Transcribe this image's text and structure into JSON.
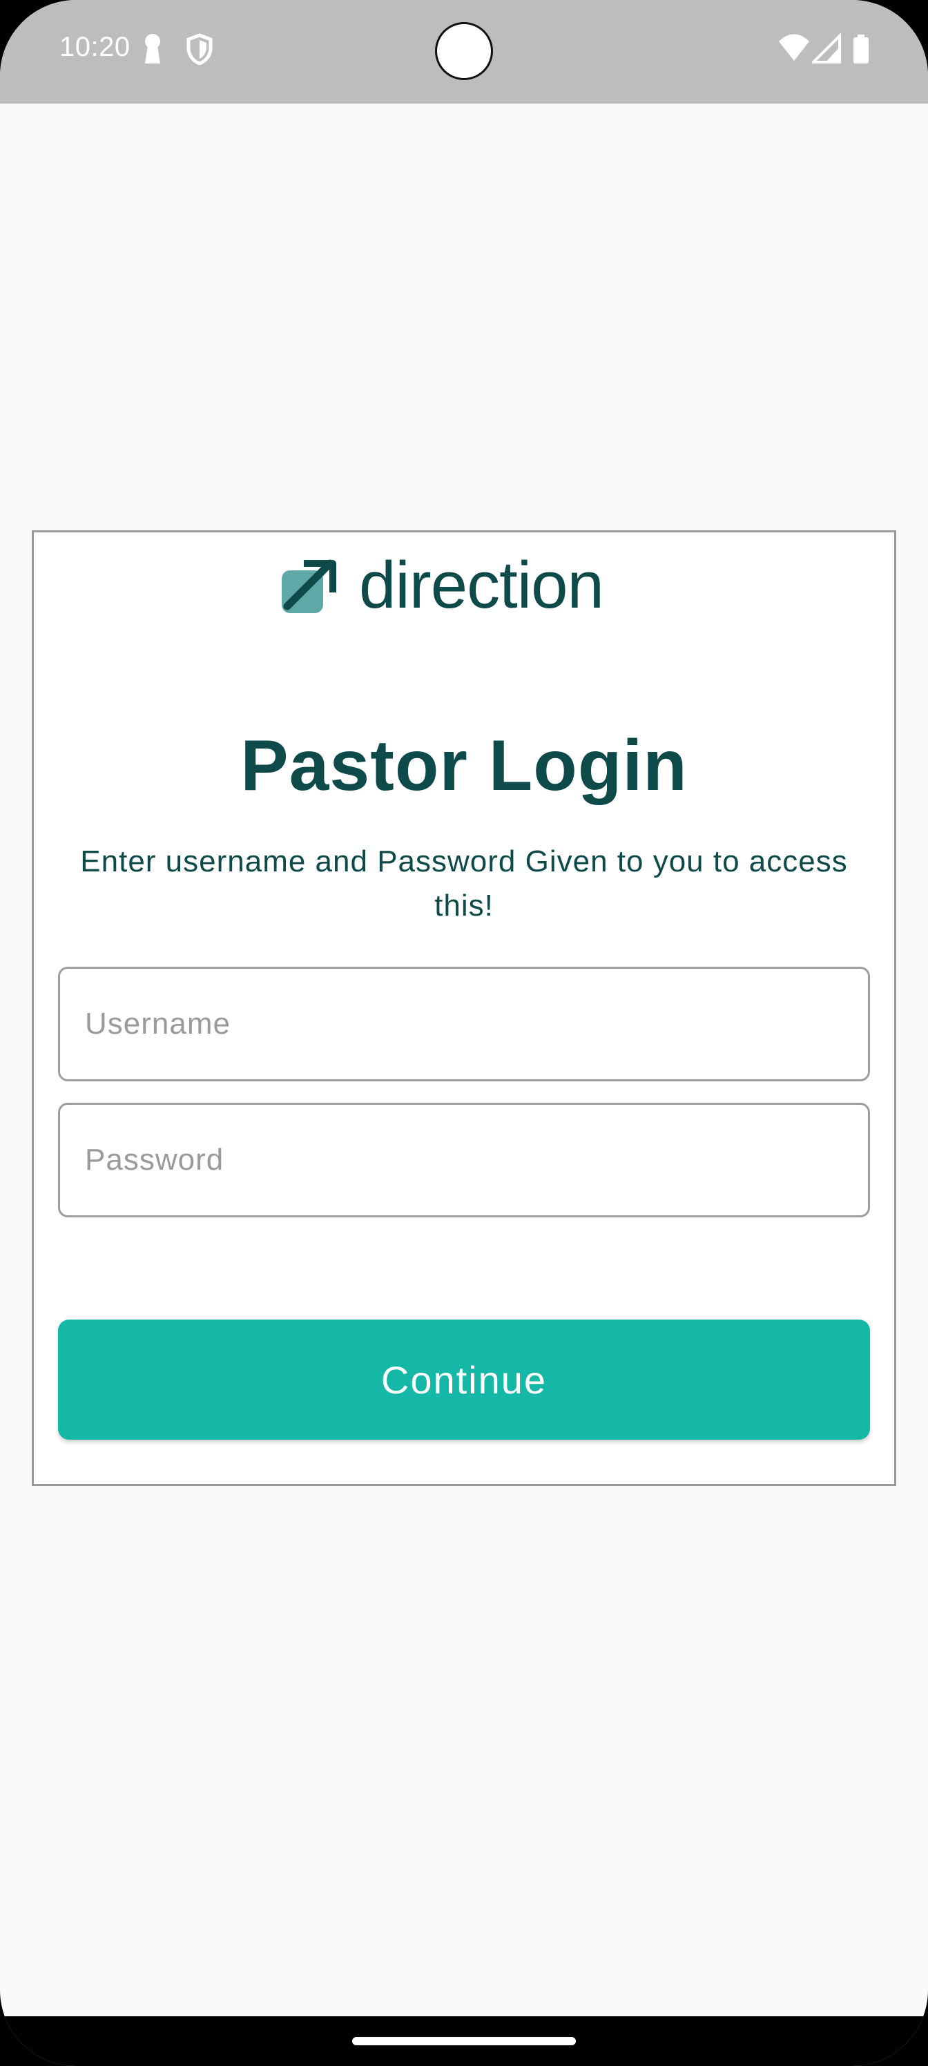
{
  "status_bar": {
    "time": "10:20",
    "left_icons": [
      "keyhole-icon",
      "shield-icon"
    ],
    "right_icons": [
      "wifi-icon",
      "cell-signal-icon",
      "battery-icon"
    ]
  },
  "logo": {
    "icon": "arrow-up-right-icon",
    "text": "direction"
  },
  "login": {
    "title": "Pastor Login",
    "subtitle": "Enter username and Password Given to you to access this!",
    "username_placeholder": "Username",
    "username_value": "",
    "password_placeholder": "Password",
    "password_value": "",
    "continue_label": "Continue"
  },
  "colors": {
    "brand_dark": "#0f4a4a",
    "accent": "#15b8a6",
    "status_bar": "#bdbdbd",
    "background": "#fafafa"
  }
}
